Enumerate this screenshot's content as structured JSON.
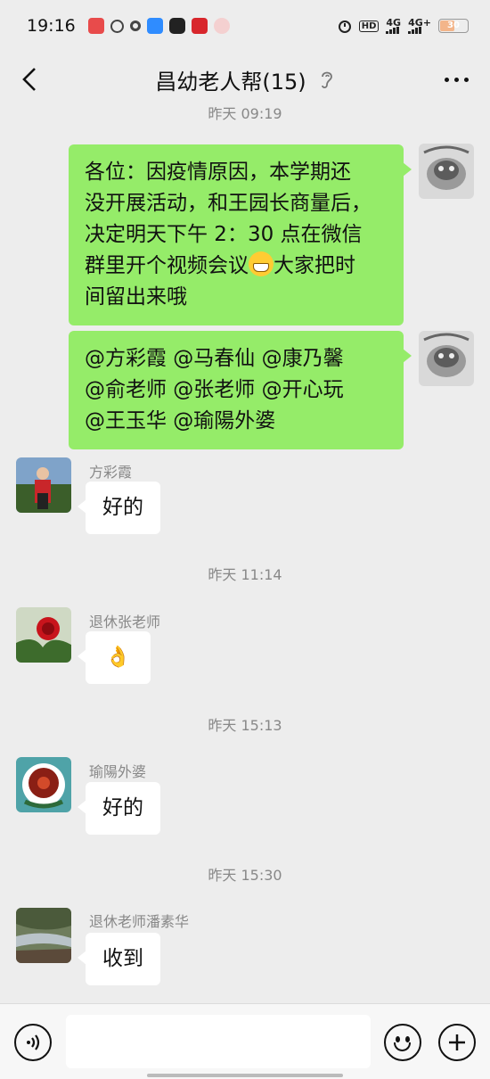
{
  "status_bar": {
    "time": "19:16",
    "network_1": "HD",
    "network_2": "4G",
    "network_3": "4G+",
    "battery": "30"
  },
  "header": {
    "title": "昌幼老人帮(15)",
    "back_icon": "chevron-left-icon",
    "mode_icon": "ear-icon",
    "more_icon": "more-dots-icon"
  },
  "chat": {
    "top_timestamp": "昨天 09:19",
    "outgoing": [
      {
        "lines": [
          "各位：因疫情原因，本学期还",
          "没开展活动，和王园长商量后，",
          "决定明天下午 2：30 点在微信",
          "群里开个视频会议",
          "大家把时",
          "间留出来哦"
        ]
      },
      {
        "lines": [
          "@方彩霞  @马春仙  @康乃馨",
          "@俞老师  @张老师  @开心玩",
          "@王玉华  @瑜陽外婆"
        ]
      }
    ],
    "incoming": [
      {
        "sender": "方彩霞",
        "text": "好的"
      },
      {
        "timestamp": "昨天 11:14",
        "sender": "退休张老师",
        "text": "👌"
      },
      {
        "timestamp": "昨天 15:13",
        "sender": "瑜陽外婆",
        "text": "好的"
      },
      {
        "timestamp": "昨天 15:30",
        "sender": "退休老师潘素华",
        "text": "收到"
      }
    ]
  },
  "input_bar": {
    "voice_icon": "voice-icon",
    "emoji_icon": "emoji-icon",
    "plus_icon": "plus-icon",
    "placeholder": ""
  },
  "colors": {
    "background": "#ededed",
    "outgoing_bubble": "#95ec69",
    "incoming_bubble": "#ffffff"
  }
}
